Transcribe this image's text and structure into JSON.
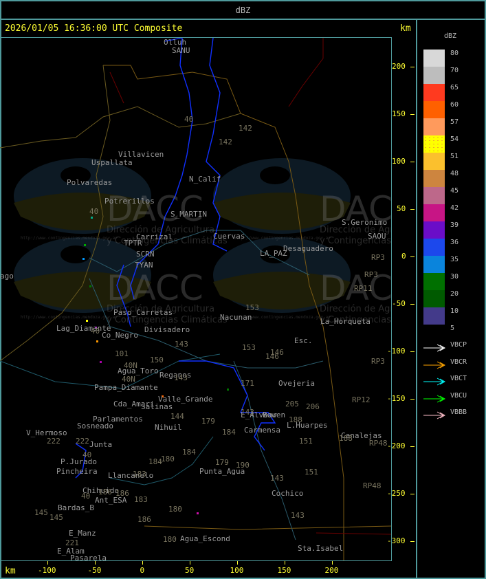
{
  "header": {
    "title": "dBZ"
  },
  "map": {
    "timestamp": "2026/01/05 16:36:00 UTC Composite",
    "unit_label_top": "km",
    "unit_label_bottom": "km",
    "y_ticks": [
      "200",
      "150",
      "100",
      "50",
      "0",
      "-50",
      "-100",
      "-150",
      "-200",
      "-250",
      "-300"
    ],
    "x_ticks": [
      "-100",
      "-50",
      "0",
      "50",
      "100",
      "150",
      "200"
    ],
    "places": [
      "Olluh",
      "SANU",
      "Villavicen",
      "Uspallata",
      "Polvaredas",
      "Potrerillos",
      "N_Calif",
      "S_MARTIN",
      "Carrizal",
      "Cuervas",
      "LA_PAZ",
      "Desaguadero",
      "S.Geronimo",
      "SAOU",
      "Paso_Carretas",
      "Divisadero",
      "Nacunan",
      "La_Horqueta",
      "Lag_Diamante",
      "Co_Negro",
      "Esc.",
      "Agua_Toro",
      "Reganos",
      "Pampa_Diamante",
      "Valle_Grande",
      "Salinas",
      "Ovejeria",
      "Cda_Amari",
      "Parlamentos",
      "Sosneado",
      "Nihuil",
      "L_Alvear",
      "Bowen",
      "Carmensa",
      "L.Huarpes",
      "Canalejas",
      "V_Hermoso",
      "Junta",
      "P.Jurado",
      "Pincheira",
      "Llancanelo",
      "Chihuido",
      "Ant_ESA",
      "Bardas_B",
      "Punta_Agua",
      "Cochico",
      "Agua_Escond",
      "E_Manz",
      "E_Alam",
      "Pasarela",
      "Sta.Isabel",
      "ago",
      "TYAN",
      "SCRN",
      "TPTR"
    ],
    "routes": [
      "40",
      "142",
      "142",
      "40",
      "40",
      "153",
      "146",
      "153",
      "146",
      "171",
      "143",
      "101",
      "40N",
      "150",
      "40N",
      "143",
      "144",
      "179",
      "184",
      "205",
      "206",
      "188",
      "151",
      "188",
      "180",
      "184",
      "184",
      "183",
      "179",
      "190",
      "183",
      "186",
      "186",
      "180",
      "143",
      "151",
      "143",
      "145",
      "145",
      "221",
      "40",
      "180",
      "186",
      "RP3",
      "RP3",
      "RP11",
      "RP3",
      "RP12",
      "RP48",
      "RP48",
      "222",
      "222",
      "40",
      "143"
    ],
    "watermark": {
      "brand": "DACC",
      "line1": "Dirección de Agricultura",
      "line2": "y Contingencias Climáticas",
      "url": "http://www.contingencias.mendoza.gov.ar"
    }
  },
  "legend": {
    "title": "dBZ",
    "levels": [
      {
        "label": "80",
        "color": "#d8d8d8"
      },
      {
        "label": "70",
        "color": "#bdbdbd"
      },
      {
        "label": "65",
        "color": "#ff3a1f"
      },
      {
        "label": "60",
        "color": "#ff6000"
      },
      {
        "label": "57",
        "color": "#ff9a5c"
      },
      {
        "label": "54",
        "color": "#ffff00"
      },
      {
        "label": "51",
        "color": "#fbc02d"
      },
      {
        "label": "48",
        "color": "#cd853f"
      },
      {
        "label": "45",
        "color": "#bd688a"
      },
      {
        "label": "42",
        "color": "#c71585"
      },
      {
        "label": "39",
        "color": "#6a0dc8"
      },
      {
        "label": "36",
        "color": "#1c48ec"
      },
      {
        "label": "35",
        "color": "#0a84dc"
      },
      {
        "label": "30",
        "color": "#007000"
      },
      {
        "label": "20",
        "color": "#005a00"
      },
      {
        "label": "10",
        "color": "#433a8a"
      },
      {
        "label": "5",
        "color": null
      }
    ],
    "radars": [
      {
        "label": "VBCP",
        "color": "#ffffff"
      },
      {
        "label": "VBCR",
        "color": "#ffa500"
      },
      {
        "label": "VBCT",
        "color": "#00ffff"
      },
      {
        "label": "VBCU",
        "color": "#00ff00"
      },
      {
        "label": "VBBB",
        "color": "#ffc0cb"
      }
    ]
  }
}
